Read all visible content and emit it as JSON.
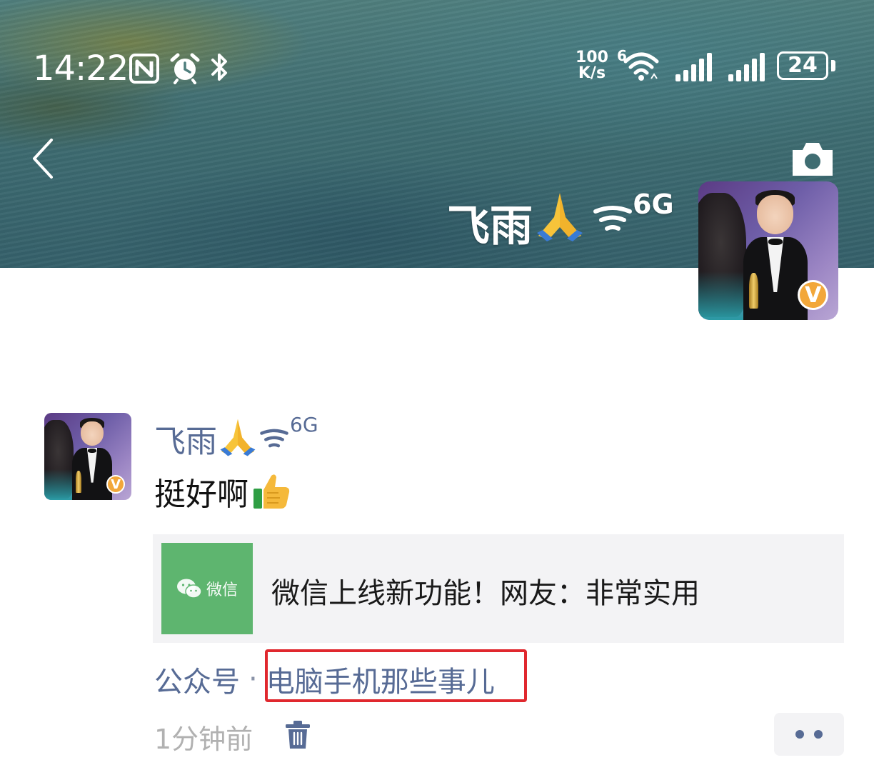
{
  "status_bar": {
    "time": "14:22",
    "net_speed_value": "100",
    "net_speed_unit": "K/s",
    "wifi_generation": "6",
    "battery_level": "24",
    "icons": [
      "nfc-icon",
      "alarm-icon",
      "bluetooth-icon",
      "wifi-icon",
      "signal-icon",
      "battery-icon"
    ]
  },
  "header": {
    "back_icon": "chevron-left-icon",
    "camera_icon": "camera-icon",
    "profile_name": "飞雨",
    "profile_name_suffix": "6G",
    "verified_badge": "V"
  },
  "post": {
    "author_name": "飞雨",
    "author_name_suffix": "6G",
    "verified_badge": "V",
    "text": "挺好啊",
    "link_card": {
      "thumb_text": "微信",
      "title": "微信上线新功能！网友：非常实用"
    },
    "source_label": "公众号",
    "source_separator": "·",
    "source_name": "电脑手机那些事儿",
    "time": "1分钟前"
  },
  "colors": {
    "link_blue": "#576b95",
    "highlight_red": "#e0282e",
    "wechat_green": "#5eb56f",
    "badge_orange": "#f2a73a"
  }
}
